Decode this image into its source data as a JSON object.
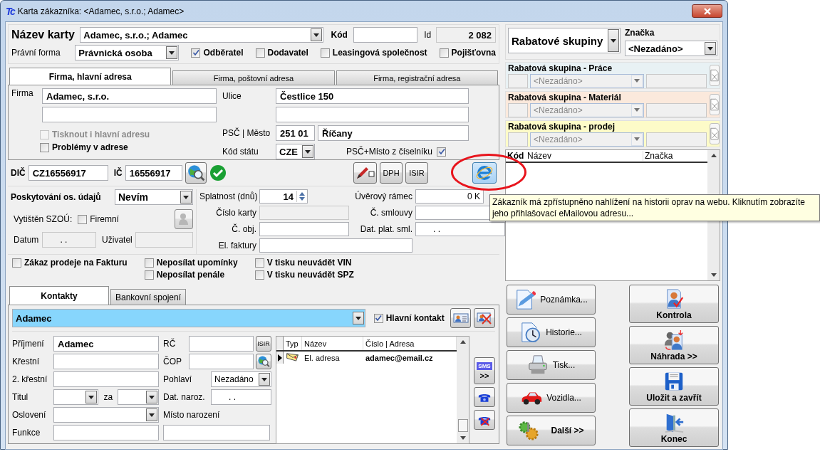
{
  "window": {
    "logo": "Tc",
    "title": "Karta zákazníka: <Adamec, s.r.o.; Adamec>"
  },
  "header": {
    "card_name": {
      "label": "Název karty",
      "value": "Adamec, s.r.o.; Adamec"
    },
    "code": {
      "label": "Kód"
    },
    "id": {
      "label": "Id",
      "value": "2 082"
    },
    "legal_form": {
      "label": "Právní forma",
      "value": "Právnická osoba"
    },
    "roles": [
      {
        "label": "Odběratel",
        "checked": true
      },
      {
        "label": "Dodavatel",
        "checked": false
      },
      {
        "label": "Leasingová společnost",
        "checked": false
      },
      {
        "label": "Pojišťovna",
        "checked": false
      }
    ]
  },
  "address_tabs": [
    {
      "label": "Firma, hlavní adresa",
      "selected": true
    },
    {
      "label": "Firma, poštovní adresa",
      "selected": false
    },
    {
      "label": "Firma, registrační adresa",
      "selected": false
    }
  ],
  "address": {
    "company": {
      "label": "Firma",
      "value": "Adamec, s.r.o."
    },
    "print_main": {
      "label": "Tisknout i hlavní adresu",
      "checked": false,
      "disabled": true
    },
    "problems": {
      "label": "Problémy v adrese",
      "checked": false,
      "disabled": false
    },
    "street": {
      "label": "Ulice",
      "value": "Čestlice 150"
    },
    "zip_city": {
      "label": "PSČ | Město",
      "zip": "251 01",
      "city": "Říčany"
    },
    "country": {
      "label": "Kód státu",
      "value": "CZE"
    },
    "zip_from_list": {
      "label": "PSČ+Místo z číselníku",
      "checked": true
    }
  },
  "tax": {
    "dic": {
      "label": "DIČ",
      "value": "CZ16556917"
    },
    "ic": {
      "label": "IČ",
      "value": "16556917"
    },
    "verified": true,
    "buttons": [
      {
        "kind": "pen"
      },
      {
        "kind": "text",
        "label": "DPH"
      },
      {
        "kind": "text",
        "label": "ISIR"
      },
      {
        "kind": "web"
      }
    ]
  },
  "details": {
    "consent": {
      "label": "Poskytování os. údajů",
      "value": "Nevím"
    },
    "printed": {
      "label": "Vytištěn SZOÚ:",
      "company": {
        "label": "Firemní",
        "checked": false
      }
    },
    "date": {
      "label": "Datum",
      "value": ". .",
      "disabled": true
    },
    "user": {
      "label": "Uživatel",
      "disabled": true
    },
    "due": {
      "label": "Splatnost (dnů)",
      "value": "14"
    },
    "card_number": {
      "label": "Číslo karty",
      "disabled": true
    },
    "order_number": {
      "label": "Č. obj.",
      "disabled": false
    },
    "e_invoice": {
      "label": "El. faktury",
      "disabled": false
    },
    "credit_limit": {
      "label": "Úvěrový rámec",
      "value": "0 K",
      "disabled": false
    },
    "contract_number": {
      "label": "Č. smlouvy",
      "disabled": false
    },
    "contract_valid": {
      "label": "Dat. plat. sml.",
      "value": ". .",
      "disabled": false
    }
  },
  "flag_columns": [
    [
      {
        "label": "Zákaz prodeje na Fakturu",
        "checked": false
      }
    ],
    [
      {
        "label": "Neposílat upomínky",
        "checked": false
      },
      {
        "label": "Neposílat penále",
        "checked": false
      }
    ],
    [
      {
        "label": "V tisku neuvádět VIN",
        "checked": false
      },
      {
        "label": "V tisku neuvádět SPZ",
        "checked": false
      }
    ]
  ],
  "contact_tabs": [
    {
      "label": "Kontakty",
      "selected": true
    },
    {
      "label": "Bankovní spojení",
      "selected": false
    }
  ],
  "contact": {
    "selected_contact": "Adamec",
    "main_contact": {
      "label": "Hlavní kontakt",
      "checked": true
    },
    "surname": {
      "label": "Příjmení",
      "value": "Adamec"
    },
    "first_name": {
      "label": "Křestní"
    },
    "second_name": {
      "label": "2. křestní"
    },
    "title": {
      "label": "Titul",
      "after_label": "za"
    },
    "salutation": {
      "label": "Oslovení"
    },
    "position": {
      "label": "Funkce"
    },
    "birth_number": {
      "label": "RČ",
      "button": "ISIR"
    },
    "id_card": {
      "label": "ČOP"
    },
    "gender": {
      "label": "Pohlaví",
      "value": "Nezadáno"
    },
    "birth_date": {
      "label": "Dat. naroz.",
      "value": ". ."
    },
    "birth_place": {
      "label": "Místo narození"
    }
  },
  "connections": {
    "columns": [
      "Typ",
      "Název",
      "Číslo | Adresa"
    ],
    "rows": [
      {
        "kind": "email",
        "name": "El. adresa",
        "value": "adamec@email.cz",
        "selected": true
      }
    ]
  },
  "contact_buttons": [
    {
      "kind": "sms",
      "icon_text": "SMS",
      "label": ">>"
    },
    {
      "kind": "phone"
    },
    {
      "kind": "phone_off"
    }
  ],
  "discounts": {
    "group_label": "Rabatové skupiny",
    "brand": {
      "label": "Značka",
      "value": "<Nezadáno>"
    },
    "groups": [
      {
        "label": "Rabatová skupina - Práce",
        "value": "<Nezadáno>",
        "color": "#e8f1f4"
      },
      {
        "label": "Rabatová skupina - Materiál",
        "value": "<Nezadáno>",
        "color": "#fbe9dc"
      },
      {
        "label": "Rabatová skupina - prodej",
        "value": "<Nezadáno>",
        "color": "#fdfbc8"
      }
    ]
  },
  "discount_table": {
    "columns": [
      "Kód",
      "Název",
      "Značka"
    ]
  },
  "actions": [
    {
      "kind": "note",
      "label": "Poznámka..."
    },
    {
      "kind": "history",
      "label": "Historie..."
    },
    {
      "kind": "print",
      "label": "Tisk..."
    },
    {
      "kind": "vehicles",
      "label": "Vozidla..."
    },
    {
      "kind": "more",
      "label": "Další >>"
    }
  ],
  "main_actions": [
    {
      "kind": "check",
      "label": "Kontrola"
    },
    {
      "kind": "replace",
      "label": "Náhrada >>"
    },
    {
      "kind": "save",
      "label": "Uložit a zavřít"
    },
    {
      "kind": "exit",
      "label": "Konec"
    }
  ],
  "tooltip": "Zákazník má zpřístupněno nahlížení na historii oprav na webu. Kliknutím zobrazíte jeho přihlašovací eMailovou adresu..."
}
